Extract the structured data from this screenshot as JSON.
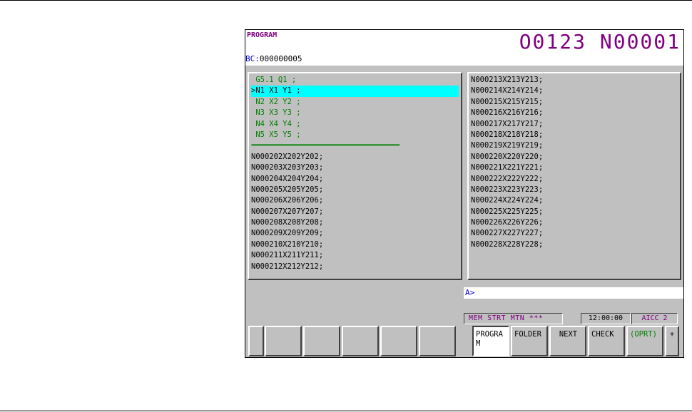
{
  "header": {
    "title": "PROGRAM",
    "program_number": "O0123 N00001"
  },
  "block_count": {
    "label": "BC:",
    "value": "000000005"
  },
  "left_panel": {
    "lines": [
      {
        "text": " G5.1 Q1 ;",
        "style": "green"
      },
      {
        "text": ">N1 X1 Y1 ;",
        "style": "cursor"
      },
      {
        "text": " N2 X2 Y2 ;",
        "style": "green"
      },
      {
        "text": " N3 X3 Y3 ;",
        "style": "green"
      },
      {
        "text": " N4 X4 Y4 ;",
        "style": "green"
      },
      {
        "text": " N5 X5 Y5 ;",
        "style": "green"
      },
      {
        "text": "=======================================",
        "style": "sep"
      },
      {
        "text": "N000202X202Y202;",
        "style": "normal"
      },
      {
        "text": "N000203X203Y203;",
        "style": "normal"
      },
      {
        "text": "N000204X204Y204;",
        "style": "normal"
      },
      {
        "text": "N000205X205Y205;",
        "style": "normal"
      },
      {
        "text": "N000206X206Y206;",
        "style": "normal"
      },
      {
        "text": "N000207X207Y207;",
        "style": "normal"
      },
      {
        "text": "N000208X208Y208;",
        "style": "normal"
      },
      {
        "text": "N000209X209Y209;",
        "style": "normal"
      },
      {
        "text": "N000210X210Y210;",
        "style": "normal"
      },
      {
        "text": "N000211X211Y211;",
        "style": "normal"
      },
      {
        "text": "N000212X212Y212;",
        "style": "normal"
      }
    ]
  },
  "right_panel": {
    "lines": [
      "N000213X213Y213;",
      "N000214X214Y214;",
      "N000215X215Y215;",
      "N000216X216Y216;",
      "N000217X217Y217;",
      "N000218X218Y218;",
      "N000219X219Y219;",
      "N000220X220Y220;",
      "N000221X221Y221;",
      "N000222X222Y222;",
      "N000223X223Y223;",
      "N000224X224Y224;",
      "N000225X225Y225;",
      "N000226X226Y226;",
      "N000227X227Y227;",
      "N000228X228Y228;"
    ]
  },
  "input_line": {
    "prompt": "A>",
    "value": ""
  },
  "status": {
    "mode": "MEM  STRT MTN ***",
    "time": "12:00:00",
    "aicc": "AICC 2"
  },
  "soft_keys": {
    "blank_count": 6,
    "program": "PROGRA M",
    "folder": "FOLDER",
    "next": "NEXT",
    "check": "CHECK",
    "oprt": "(OPRT)",
    "more": "+"
  },
  "colors": {
    "title": "#800080",
    "bc_label": "#0000cc",
    "green_text": "#008000",
    "cursor": "#00ffff",
    "panel": "#c0c0c0"
  }
}
